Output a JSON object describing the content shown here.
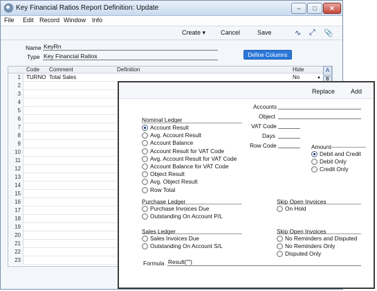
{
  "window": {
    "title": "Key Financial Ratios Report Definition: Update"
  },
  "menubar": {
    "items": [
      "File",
      "Edit",
      "Record",
      "Window",
      "Info"
    ]
  },
  "toolbar": {
    "create_label": "Create",
    "cancel_label": "Cancel",
    "save_label": "Save"
  },
  "header": {
    "name_label": "Name",
    "name_value": "KeyRn",
    "type_label": "Type",
    "type_value": "Key Financial Ratios",
    "define_columns_label": "Define Columns"
  },
  "grid": {
    "columns": [
      "Code",
      "Comment",
      "Definition",
      "Hide"
    ],
    "row_numbers": [
      "1",
      "2",
      "3",
      "4",
      "5",
      "6",
      "7",
      "8",
      "9",
      "10",
      "11",
      "12",
      "13",
      "14",
      "15",
      "16",
      "17",
      "18",
      "19",
      "20",
      "21",
      "22",
      "23"
    ],
    "row1": {
      "code": "TURNO",
      "comment": "Total Sales",
      "definition": "",
      "hide": "No"
    },
    "side_tab_a": "A",
    "side_tab_b": "B"
  },
  "panel": {
    "replace_label": "Replace",
    "add_label": "Add",
    "accounts_label": "Accounts",
    "object_label": "Object",
    "vat_code_label": "VAT Code",
    "days_label": "Days",
    "row_code_label": "Row Code",
    "nominal_ledger": {
      "title": "Nominal Ledger",
      "options": [
        "Account Result",
        "Avg. Account Result",
        "Account Balance",
        "Account Result for VAT Code",
        "Avg. Account Result for VAT Code",
        "Account Balance for VAT Code",
        "Object Result",
        "Avg. Object Result",
        "Row Total"
      ],
      "selected": "Account Result"
    },
    "amount": {
      "title": "Amount",
      "options": [
        "Debit and Credit",
        "Debit Only",
        "Credit Only"
      ],
      "selected": "Debit and Credit"
    },
    "purchase_ledger": {
      "title": "Purchase Ledger",
      "options": [
        "Purchase Invoices Due",
        "Outstanding On Account P/L"
      ]
    },
    "skip_open_invoices_1": {
      "title": "Skip Open Invoices",
      "options": [
        "On Hold"
      ]
    },
    "sales_ledger": {
      "title": "Sales Ledger",
      "options": [
        "Sales Invoices Due",
        "Outstanding On Account S/L"
      ]
    },
    "skip_open_invoices_2": {
      "title": "Skip Open Invoices",
      "options": [
        "No Reminders and Disputed",
        "No Reminders Only",
        "Disputed Only"
      ]
    },
    "formula_label": "Formula",
    "formula_value": "Result(\"\")"
  }
}
